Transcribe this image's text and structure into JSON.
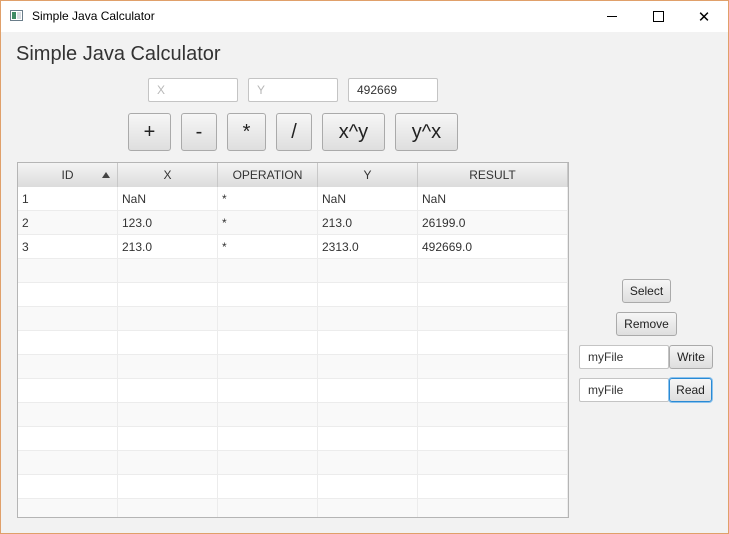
{
  "window": {
    "title": "Simple Java Calculator"
  },
  "app": {
    "heading": "Simple Java Calculator"
  },
  "inputs": {
    "x": {
      "value": "",
      "placeholder": "X"
    },
    "y": {
      "value": "",
      "placeholder": "Y"
    },
    "result": {
      "value": "492669",
      "placeholder": ""
    }
  },
  "operations": [
    {
      "label": "+"
    },
    {
      "label": "-"
    },
    {
      "label": "*"
    },
    {
      "label": "/"
    },
    {
      "label": "x^y"
    },
    {
      "label": "y^x"
    }
  ],
  "table": {
    "columns": [
      "ID",
      "X",
      "OPERATION",
      "Y",
      "RESULT"
    ],
    "sort_column": "ID",
    "sort_direction": "ascending",
    "rows": [
      {
        "id": "1",
        "x": "NaN",
        "operation": "*",
        "y": "NaN",
        "result": "NaN"
      },
      {
        "id": "2",
        "x": "123.0",
        "operation": "*",
        "y": "213.0",
        "result": "26199.0"
      },
      {
        "id": "3",
        "x": "213.0",
        "operation": "*",
        "y": "2313.0",
        "result": "492669.0"
      }
    ]
  },
  "side": {
    "select_label": "Select",
    "remove_label": "Remove",
    "write_file": "myFile",
    "write_label": "Write",
    "read_file": "myFile",
    "read_label": "Read"
  }
}
